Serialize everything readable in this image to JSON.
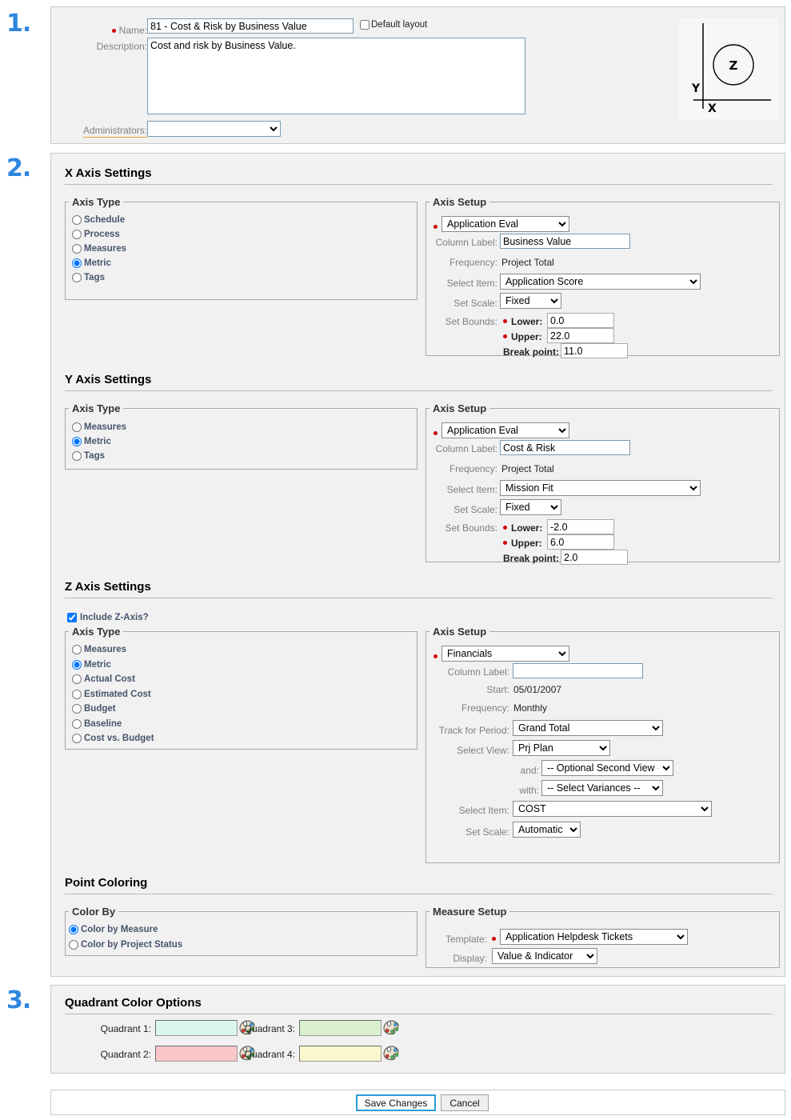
{
  "steps": {
    "one": "1.",
    "two": "2.",
    "three": "3."
  },
  "general": {
    "name_label": "Name:",
    "name_value": "81 - Cost & Risk by Business Value",
    "default_layout_label": "Default layout",
    "default_layout_checked": false,
    "description_label": "Description:",
    "description_value": "Cost and risk by Business Value.",
    "administrators_label": "Administrators:",
    "administrators_value": "",
    "thumbnail": {
      "x_label": "X",
      "y_label": "Y",
      "z_label": "Z"
    }
  },
  "x_axis": {
    "section_title": "X Axis Settings",
    "axis_type_legend": "Axis Type",
    "axis_type_options": [
      "Schedule",
      "Process",
      "Measures",
      "Metric",
      "Tags"
    ],
    "axis_type_selected": "Metric",
    "setup_legend": "Axis Setup",
    "source_value": "Application Eval",
    "column_label_label": "Column Label:",
    "column_label_value": "Business Value",
    "frequency_label": "Frequency:",
    "frequency_value": "Project Total",
    "select_item_label": "Select Item:",
    "select_item_value": "Application Score",
    "set_scale_label": "Set Scale:",
    "set_scale_value": "Fixed",
    "set_bounds_label": "Set Bounds:",
    "lower_label": "Lower:",
    "lower_value": "0.0",
    "upper_label": "Upper:",
    "upper_value": "22.0",
    "break_point_label": "Break point:",
    "break_point_value": "11.0"
  },
  "y_axis": {
    "section_title": "Y Axis Settings",
    "axis_type_legend": "Axis Type",
    "axis_type_options": [
      "Measures",
      "Metric",
      "Tags"
    ],
    "axis_type_selected": "Metric",
    "setup_legend": "Axis Setup",
    "source_value": "Application Eval",
    "column_label_label": "Column Label:",
    "column_label_value": "Cost & Risk",
    "frequency_label": "Frequency:",
    "frequency_value": "Project Total",
    "select_item_label": "Select Item:",
    "select_item_value": "Mission Fit",
    "set_scale_label": "Set Scale:",
    "set_scale_value": "Fixed",
    "set_bounds_label": "Set Bounds:",
    "lower_label": "Lower:",
    "lower_value": "-2.0",
    "upper_label": "Upper:",
    "upper_value": "6.0",
    "break_point_label": "Break point:",
    "break_point_value": "2.0"
  },
  "z_axis": {
    "section_title": "Z Axis Settings",
    "include_label": "Include Z-Axis?",
    "include_checked": true,
    "axis_type_legend": "Axis Type",
    "axis_type_options": [
      "Measures",
      "Metric",
      "Actual Cost",
      "Estimated Cost",
      "Budget",
      "Baseline",
      "Cost vs. Budget"
    ],
    "axis_type_selected": "Metric",
    "setup_legend": "Axis Setup",
    "source_value": "Financials",
    "column_label_label": "Column Label:",
    "column_label_value": "",
    "start_label": "Start:",
    "start_value": "05/01/2007",
    "frequency_label": "Frequency:",
    "frequency_value": "Monthly",
    "track_period_label": "Track for Period:",
    "track_period_value": "Grand Total",
    "select_view_label": "Select View:",
    "select_view_value": "Prj Plan",
    "and_label": "and:",
    "and_value": "-- Optional Second View --",
    "with_label": "with:",
    "with_value": "-- Select Variances --",
    "select_item_label": "Select Item:",
    "select_item_value": "COST",
    "set_scale_label": "Set Scale:",
    "set_scale_value": "Automatic"
  },
  "point_coloring": {
    "section_title": "Point Coloring",
    "color_by_legend": "Color By",
    "color_by_options": [
      "Color by Measure",
      "Color by Project Status"
    ],
    "color_by_selected": "Color by Measure",
    "measure_setup_legend": "Measure Setup",
    "template_label": "Template:",
    "template_value": "Application Helpdesk Tickets",
    "display_label": "Display:",
    "display_value": "Value & Indicator"
  },
  "quadrants": {
    "section_title": "Quadrant Color Options",
    "items": [
      {
        "label": "Quadrant 1:",
        "color": "#d9f7ef"
      },
      {
        "label": "Quadrant 2:",
        "color": "#f9c7ca"
      },
      {
        "label": "Quadrant 3:",
        "color": "#d9f0ce"
      },
      {
        "label": "Quadrant 4:",
        "color": "#fbf7cd"
      }
    ],
    "picker_icon": "palette-icon"
  },
  "footer": {
    "save_label": "Save Changes",
    "cancel_label": "Cancel"
  },
  "colors": {
    "accent": "#2e86de",
    "required": "#d00000",
    "panel_bg": "#f1f1f1",
    "panel_border": "#c9c9c9"
  }
}
